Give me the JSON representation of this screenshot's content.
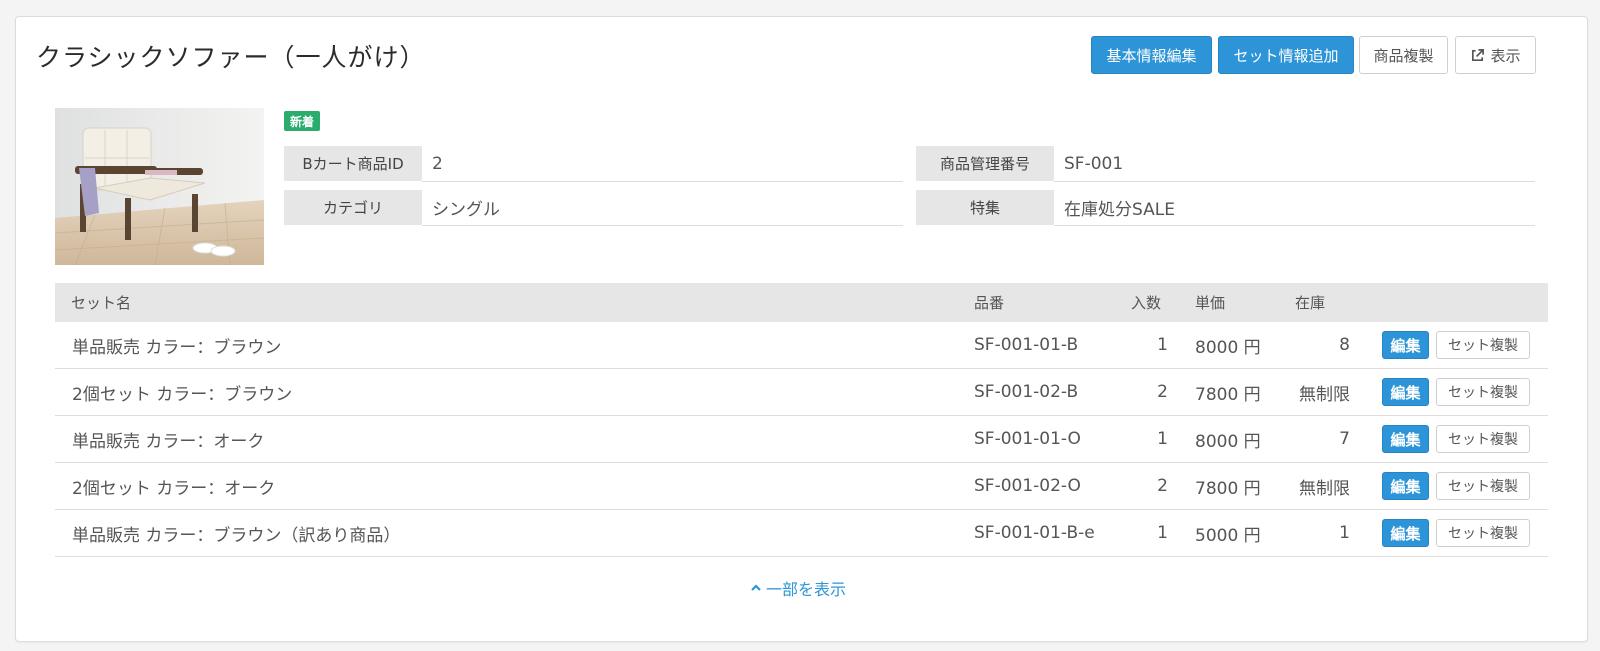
{
  "product": {
    "title": "クラシックソファー（一人がけ）",
    "badge": "新着",
    "fields": {
      "bcart_id_label": "Bカート商品ID",
      "bcart_id_value": "2",
      "manage_no_label": "商品管理番号",
      "manage_no_value": "SF-001",
      "category_label": "カテゴリ",
      "category_value": "シングル",
      "feature_label": "特集",
      "feature_value": "在庫処分SALE"
    }
  },
  "toolbar": {
    "edit_basic": "基本情報編集",
    "add_set": "セット情報追加",
    "duplicate": "商品複製",
    "view": "表示"
  },
  "table": {
    "headers": {
      "set_name": "セット名",
      "part_no": "品番",
      "qty": "入数",
      "price": "単価",
      "stock": "在庫"
    },
    "edit_label": "編集",
    "copy_label": "セット複製",
    "rows": [
      {
        "name": "単品販売 カラー：ブラウン",
        "part_no": "SF-001-01-B",
        "qty": "1",
        "price": "8000 円",
        "stock": "8"
      },
      {
        "name": "2個セット カラー：ブラウン",
        "part_no": "SF-001-02-B",
        "qty": "2",
        "price": "7800 円",
        "stock": "無制限"
      },
      {
        "name": "単品販売 カラー：オーク",
        "part_no": "SF-001-01-O",
        "qty": "1",
        "price": "8000 円",
        "stock": "7"
      },
      {
        "name": "2個セット カラー：オーク",
        "part_no": "SF-001-02-O",
        "qty": "2",
        "price": "7800 円",
        "stock": "無制限"
      },
      {
        "name": "単品販売 カラー：ブラウン（訳あり商品）",
        "part_no": "SF-001-01-B-e",
        "qty": "1",
        "price": "5000 円",
        "stock": "1"
      }
    ]
  },
  "footer": {
    "collapse_label": "一部を表示"
  },
  "icons": {
    "external": "external-link-icon",
    "chevron": "chevron-up-icon"
  },
  "colors": {
    "primary": "#2d95d7",
    "badge_green": "#2aac6c",
    "header_gray": "#e6e6e6"
  }
}
